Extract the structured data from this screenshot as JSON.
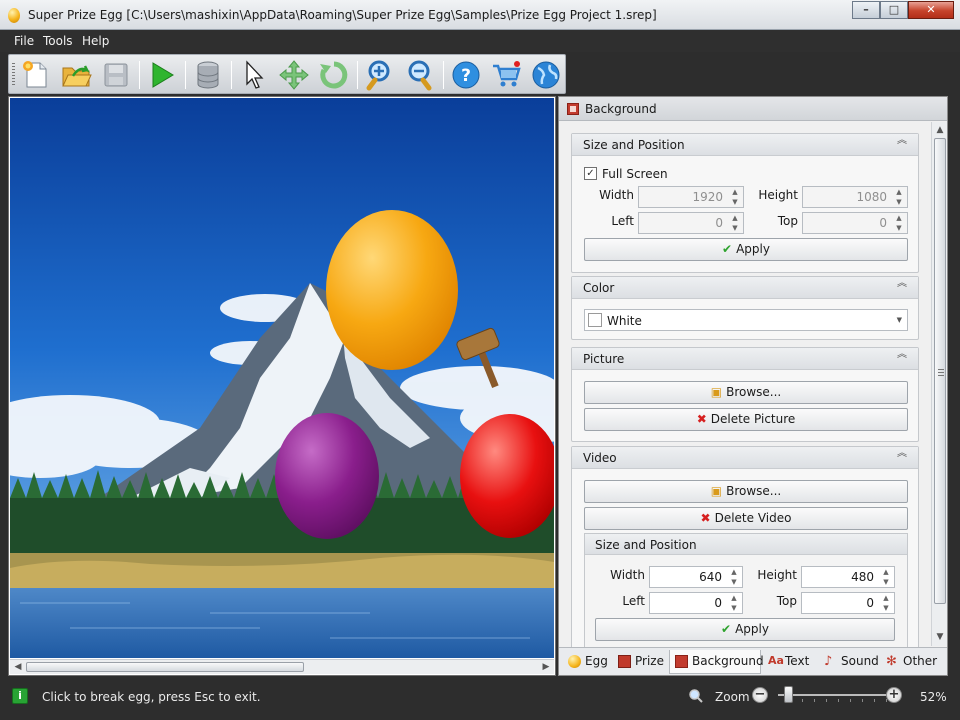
{
  "window": {
    "title": "Super Prize Egg [C:\\Users\\mashixin\\AppData\\Roaming\\Super Prize Egg\\Samples\\Prize Egg Project 1.srep]",
    "controls": {
      "minimize": "–",
      "maximize": "□",
      "close": "✕"
    }
  },
  "menu": {
    "file": "File",
    "tools": "Tools",
    "help": "Help"
  },
  "toolbar": {
    "icons": [
      "new-project-icon",
      "open-project-icon",
      "save-icon",
      "play-icon",
      "database-icon",
      "pointer-icon",
      "move-icon",
      "rotate-icon",
      "zoom-in-icon",
      "zoom-out-icon",
      "help-icon",
      "cart-icon",
      "web-icon"
    ]
  },
  "canvas": {
    "eggs": [
      {
        "color": "#f7a812",
        "name": "orange-egg"
      },
      {
        "color": "#8a1e8c",
        "name": "purple-egg"
      },
      {
        "color": "#e81010",
        "name": "red-egg"
      }
    ]
  },
  "panel": {
    "title": "Background",
    "size_position": {
      "title": "Size and Position",
      "full_screen_label": "Full Screen",
      "full_screen_checked": true,
      "width_label": "Width",
      "width": "1920",
      "height_label": "Height",
      "height": "1080",
      "left_label": "Left",
      "left": "0",
      "top_label": "Top",
      "top": "0",
      "apply_label": "Apply"
    },
    "color": {
      "title": "Color",
      "value": "White",
      "swatch": "#ffffff"
    },
    "picture": {
      "title": "Picture",
      "browse_label": "Browse...",
      "delete_label": "Delete Picture"
    },
    "video": {
      "title": "Video",
      "browse_label": "Browse...",
      "delete_label": "Delete Video",
      "size_title": "Size and Position",
      "width_label": "Width",
      "width": "640",
      "height_label": "Height",
      "height": "480",
      "left_label": "Left",
      "left": "0",
      "top_label": "Top",
      "top": "0",
      "apply_label": "Apply"
    },
    "tabs": [
      {
        "label": "Egg",
        "active": false
      },
      {
        "label": "Prize",
        "active": false
      },
      {
        "label": "Background",
        "active": true
      },
      {
        "label": "Text",
        "active": false
      },
      {
        "label": "Sound",
        "active": false
      },
      {
        "label": "Other",
        "active": false
      }
    ]
  },
  "status": {
    "message": "Click to break egg, press Esc to exit.",
    "zoom_label": "Zoom",
    "zoom_percent": "52%",
    "zoom_level": 0.05
  }
}
